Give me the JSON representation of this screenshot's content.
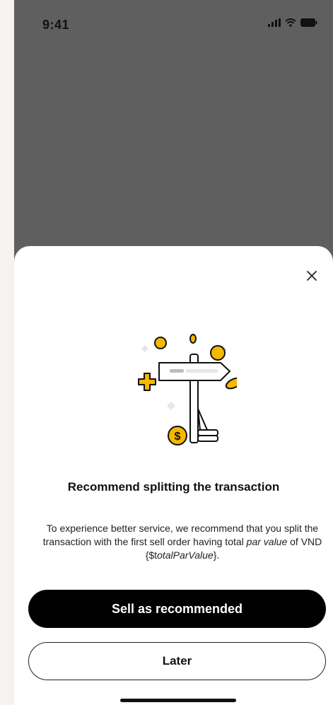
{
  "status_bar": {
    "time": "9:41"
  },
  "modal": {
    "title": "Recommend splitting the transaction",
    "description_part1": "To experience better service, we recommend that you split the transaction with the first sell order having total ",
    "description_emphasis": "par value",
    "description_part2": " of VND {$t",
    "description_variable": "otalParValue",
    "description_part3": "}.",
    "primary_button_label": "Sell as recommended",
    "secondary_button_label": "Later"
  },
  "icons": [
    "signal-icon",
    "wifi-icon",
    "battery-icon",
    "close-icon",
    "signpost-illustration"
  ],
  "colors": {
    "overlay": "#5f5f5f",
    "accent": "#f5b800",
    "primary_button": "#000000"
  }
}
